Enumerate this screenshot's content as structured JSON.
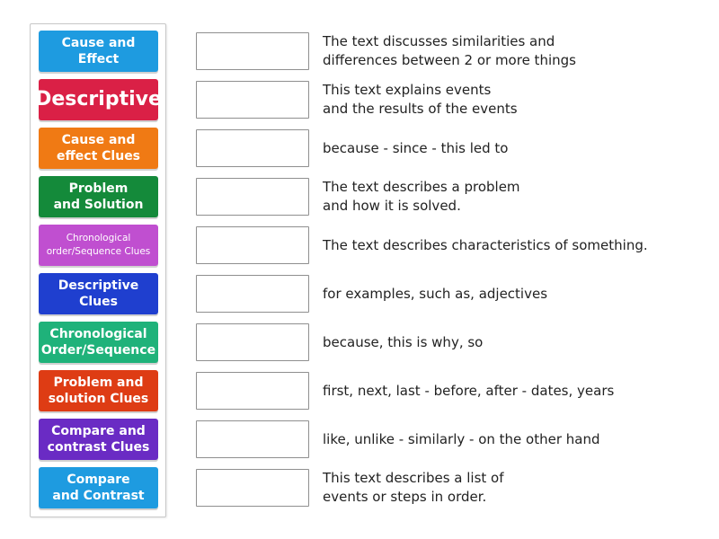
{
  "tiles": [
    {
      "label": "Cause and Effect",
      "color": "#1e9be0",
      "size": "normal"
    },
    {
      "label": "Descriptive",
      "color": "#da2046",
      "size": "big"
    },
    {
      "label": "Cause and\neffect Clues",
      "color": "#f07a14",
      "size": "normal"
    },
    {
      "label": "Problem\nand Solution",
      "color": "#148a3a",
      "size": "normal"
    },
    {
      "label": "Chronological\norder/Sequence Clues",
      "color": "#c04fd0",
      "size": "small"
    },
    {
      "label": "Descriptive\nClues",
      "color": "#1f3fcf",
      "size": "normal"
    },
    {
      "label": "Chronological\nOrder/Sequence",
      "color": "#1fb27a",
      "size": "normal"
    },
    {
      "label": "Problem and\nsolution Clues",
      "color": "#de3c14",
      "size": "normal"
    },
    {
      "label": "Compare and\ncontrast Clues",
      "color": "#6a2bc4",
      "size": "normal"
    },
    {
      "label": "Compare\nand Contrast",
      "color": "#1e9be0",
      "size": "normal"
    }
  ],
  "rows": [
    {
      "description": "The text discusses similarities and\ndifferences between 2 or more things",
      "slot_value": ""
    },
    {
      "description": "This text explains events\nand the results of the events",
      "slot_value": ""
    },
    {
      "description": "because - since - this led to",
      "slot_value": ""
    },
    {
      "description": "The text describes a problem\nand how it is solved.",
      "slot_value": ""
    },
    {
      "description": "The text describes characteristics of something.",
      "slot_value": ""
    },
    {
      "description": "for examples, such as, adjectives",
      "slot_value": ""
    },
    {
      "description": "because, this is why, so",
      "slot_value": ""
    },
    {
      "description": "first, next, last - before, after - dates, years",
      "slot_value": ""
    },
    {
      "description": "like, unlike - similarly - on the other hand",
      "slot_value": ""
    },
    {
      "description": "This text describes a list of\nevents or steps in order.",
      "slot_value": ""
    }
  ]
}
